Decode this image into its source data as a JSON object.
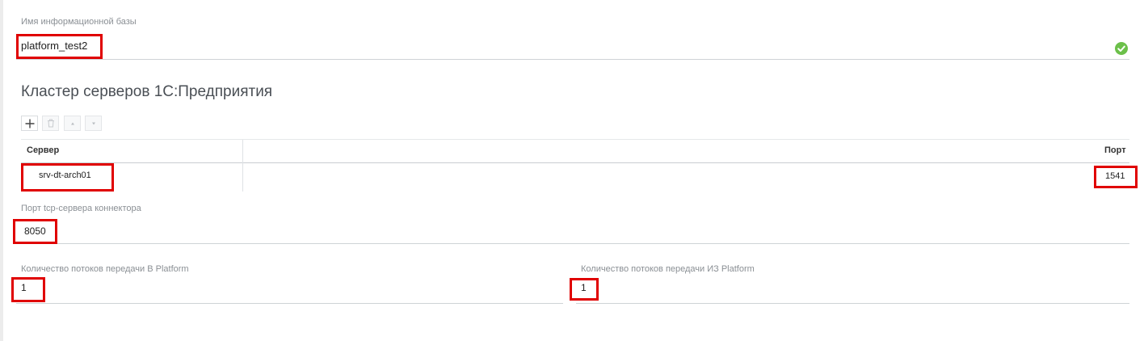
{
  "infobase": {
    "label": "Имя информационной базы",
    "value": "platform_test2",
    "status_icon": "check-circle-icon",
    "status_color": "#6cc04a"
  },
  "cluster": {
    "title": "Кластер серверов 1С:Предприятия",
    "toolbar": [
      "add-icon",
      "delete-icon",
      "move-up-icon",
      "move-down-icon"
    ],
    "columns": [
      "Сервер",
      "Порт"
    ],
    "rows": [
      {
        "server": "srv-dt-arch01",
        "port": "1541"
      }
    ]
  },
  "connector_port": {
    "label": "Порт tcp-сервера коннектора",
    "value": "8050"
  },
  "threads_to_platform": {
    "label": "Количество потоков передачи В Platform",
    "value": "1"
  },
  "threads_from_platform": {
    "label": "Количество потоков передачи ИЗ Platform",
    "value": "1"
  },
  "colors": {
    "highlight": "#e00000",
    "label": "#8a8f94",
    "divider": "#cfd3d6"
  }
}
